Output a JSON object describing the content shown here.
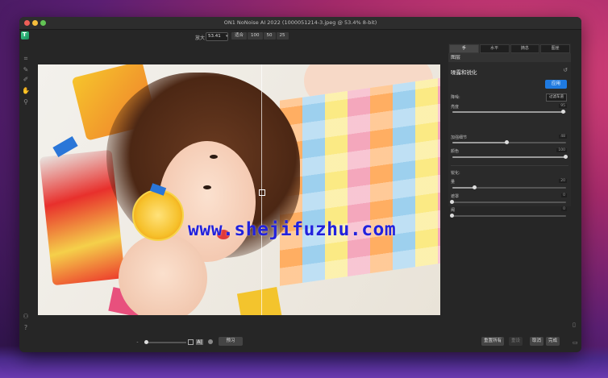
{
  "window": {
    "title": "ON1 NoNoise AI 2022 (1000051214-3.jpeg @ 53.4% 8-bit)"
  },
  "toolbar": {
    "zoom_label": "放大",
    "zoom_value": "53.41",
    "zoom_buttons": [
      "适合",
      "100",
      "50",
      "25"
    ]
  },
  "image": {
    "watermark": "www.shejifuzhu.com"
  },
  "panel": {
    "tabs": [
      "手",
      "水平",
      "摘息",
      "图崖"
    ],
    "layers_label": "图层",
    "section_title": "噪露和锐化",
    "apply_label": "应用",
    "noise_label": "降噪:",
    "filter_button": "过滤车道",
    "sliders_noise": [
      {
        "label": "亮度",
        "value": "95",
        "fraction": 0.98
      },
      {
        "label": "加强细节",
        "value": "48",
        "fraction": 0.48
      },
      {
        "label": "颜色",
        "value": "100",
        "fraction": 1.0
      }
    ],
    "sharpen_label": "锐化:",
    "sliders_sharpen": [
      {
        "label": "量",
        "value": "20",
        "fraction": 0.2
      },
      {
        "label": "遮罩",
        "value": "0",
        "fraction": 0.0
      },
      {
        "label": "阈",
        "value": "0",
        "fraction": 0.0
      }
    ]
  },
  "bottom": {
    "preview_label": "预习",
    "reset_all_label": "重置所有",
    "disabled_label": "重设",
    "cancel_label": "取消",
    "done_label": "完成"
  },
  "colors": {
    "accent": "#1f7ae0"
  }
}
